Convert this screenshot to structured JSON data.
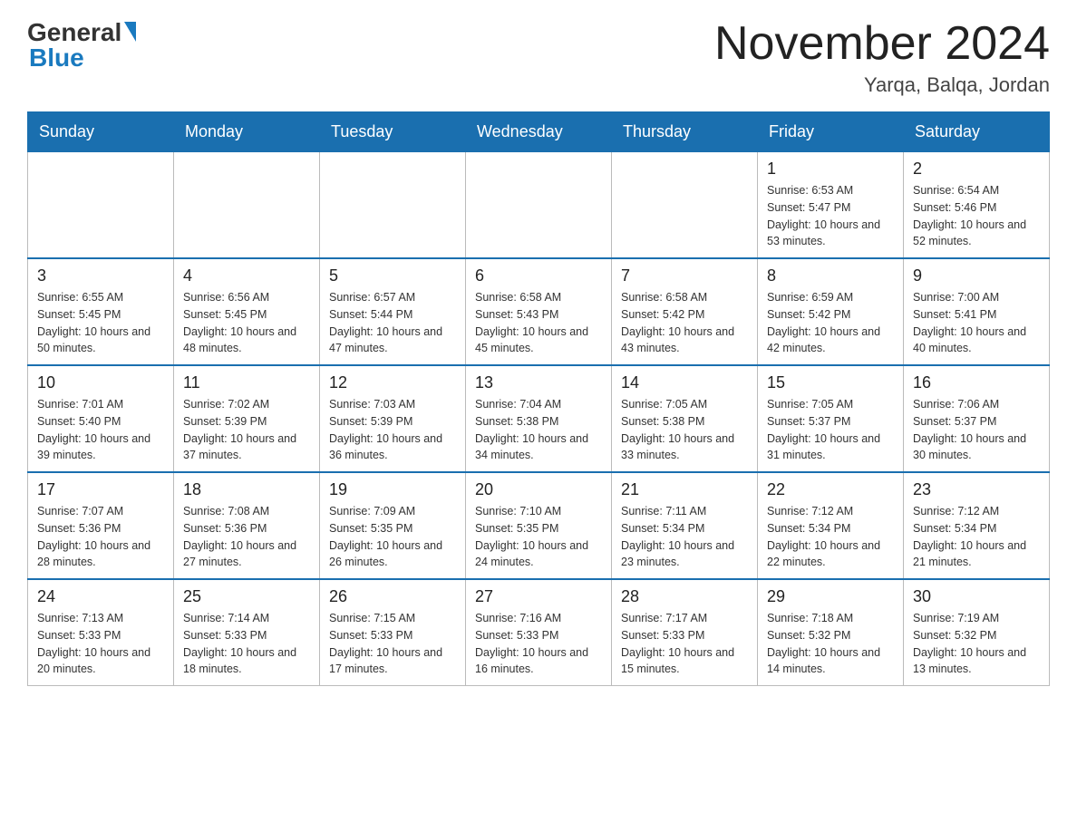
{
  "header": {
    "logo_general": "General",
    "logo_blue": "Blue",
    "month_title": "November 2024",
    "location": "Yarqa, Balqa, Jordan"
  },
  "calendar": {
    "days_of_week": [
      "Sunday",
      "Monday",
      "Tuesday",
      "Wednesday",
      "Thursday",
      "Friday",
      "Saturday"
    ],
    "weeks": [
      [
        {
          "day": "",
          "info": ""
        },
        {
          "day": "",
          "info": ""
        },
        {
          "day": "",
          "info": ""
        },
        {
          "day": "",
          "info": ""
        },
        {
          "day": "",
          "info": ""
        },
        {
          "day": "1",
          "info": "Sunrise: 6:53 AM\nSunset: 5:47 PM\nDaylight: 10 hours and 53 minutes."
        },
        {
          "day": "2",
          "info": "Sunrise: 6:54 AM\nSunset: 5:46 PM\nDaylight: 10 hours and 52 minutes."
        }
      ],
      [
        {
          "day": "3",
          "info": "Sunrise: 6:55 AM\nSunset: 5:45 PM\nDaylight: 10 hours and 50 minutes."
        },
        {
          "day": "4",
          "info": "Sunrise: 6:56 AM\nSunset: 5:45 PM\nDaylight: 10 hours and 48 minutes."
        },
        {
          "day": "5",
          "info": "Sunrise: 6:57 AM\nSunset: 5:44 PM\nDaylight: 10 hours and 47 minutes."
        },
        {
          "day": "6",
          "info": "Sunrise: 6:58 AM\nSunset: 5:43 PM\nDaylight: 10 hours and 45 minutes."
        },
        {
          "day": "7",
          "info": "Sunrise: 6:58 AM\nSunset: 5:42 PM\nDaylight: 10 hours and 43 minutes."
        },
        {
          "day": "8",
          "info": "Sunrise: 6:59 AM\nSunset: 5:42 PM\nDaylight: 10 hours and 42 minutes."
        },
        {
          "day": "9",
          "info": "Sunrise: 7:00 AM\nSunset: 5:41 PM\nDaylight: 10 hours and 40 minutes."
        }
      ],
      [
        {
          "day": "10",
          "info": "Sunrise: 7:01 AM\nSunset: 5:40 PM\nDaylight: 10 hours and 39 minutes."
        },
        {
          "day": "11",
          "info": "Sunrise: 7:02 AM\nSunset: 5:39 PM\nDaylight: 10 hours and 37 minutes."
        },
        {
          "day": "12",
          "info": "Sunrise: 7:03 AM\nSunset: 5:39 PM\nDaylight: 10 hours and 36 minutes."
        },
        {
          "day": "13",
          "info": "Sunrise: 7:04 AM\nSunset: 5:38 PM\nDaylight: 10 hours and 34 minutes."
        },
        {
          "day": "14",
          "info": "Sunrise: 7:05 AM\nSunset: 5:38 PM\nDaylight: 10 hours and 33 minutes."
        },
        {
          "day": "15",
          "info": "Sunrise: 7:05 AM\nSunset: 5:37 PM\nDaylight: 10 hours and 31 minutes."
        },
        {
          "day": "16",
          "info": "Sunrise: 7:06 AM\nSunset: 5:37 PM\nDaylight: 10 hours and 30 minutes."
        }
      ],
      [
        {
          "day": "17",
          "info": "Sunrise: 7:07 AM\nSunset: 5:36 PM\nDaylight: 10 hours and 28 minutes."
        },
        {
          "day": "18",
          "info": "Sunrise: 7:08 AM\nSunset: 5:36 PM\nDaylight: 10 hours and 27 minutes."
        },
        {
          "day": "19",
          "info": "Sunrise: 7:09 AM\nSunset: 5:35 PM\nDaylight: 10 hours and 26 minutes."
        },
        {
          "day": "20",
          "info": "Sunrise: 7:10 AM\nSunset: 5:35 PM\nDaylight: 10 hours and 24 minutes."
        },
        {
          "day": "21",
          "info": "Sunrise: 7:11 AM\nSunset: 5:34 PM\nDaylight: 10 hours and 23 minutes."
        },
        {
          "day": "22",
          "info": "Sunrise: 7:12 AM\nSunset: 5:34 PM\nDaylight: 10 hours and 22 minutes."
        },
        {
          "day": "23",
          "info": "Sunrise: 7:12 AM\nSunset: 5:34 PM\nDaylight: 10 hours and 21 minutes."
        }
      ],
      [
        {
          "day": "24",
          "info": "Sunrise: 7:13 AM\nSunset: 5:33 PM\nDaylight: 10 hours and 20 minutes."
        },
        {
          "day": "25",
          "info": "Sunrise: 7:14 AM\nSunset: 5:33 PM\nDaylight: 10 hours and 18 minutes."
        },
        {
          "day": "26",
          "info": "Sunrise: 7:15 AM\nSunset: 5:33 PM\nDaylight: 10 hours and 17 minutes."
        },
        {
          "day": "27",
          "info": "Sunrise: 7:16 AM\nSunset: 5:33 PM\nDaylight: 10 hours and 16 minutes."
        },
        {
          "day": "28",
          "info": "Sunrise: 7:17 AM\nSunset: 5:33 PM\nDaylight: 10 hours and 15 minutes."
        },
        {
          "day": "29",
          "info": "Sunrise: 7:18 AM\nSunset: 5:32 PM\nDaylight: 10 hours and 14 minutes."
        },
        {
          "day": "30",
          "info": "Sunrise: 7:19 AM\nSunset: 5:32 PM\nDaylight: 10 hours and 13 minutes."
        }
      ]
    ]
  }
}
